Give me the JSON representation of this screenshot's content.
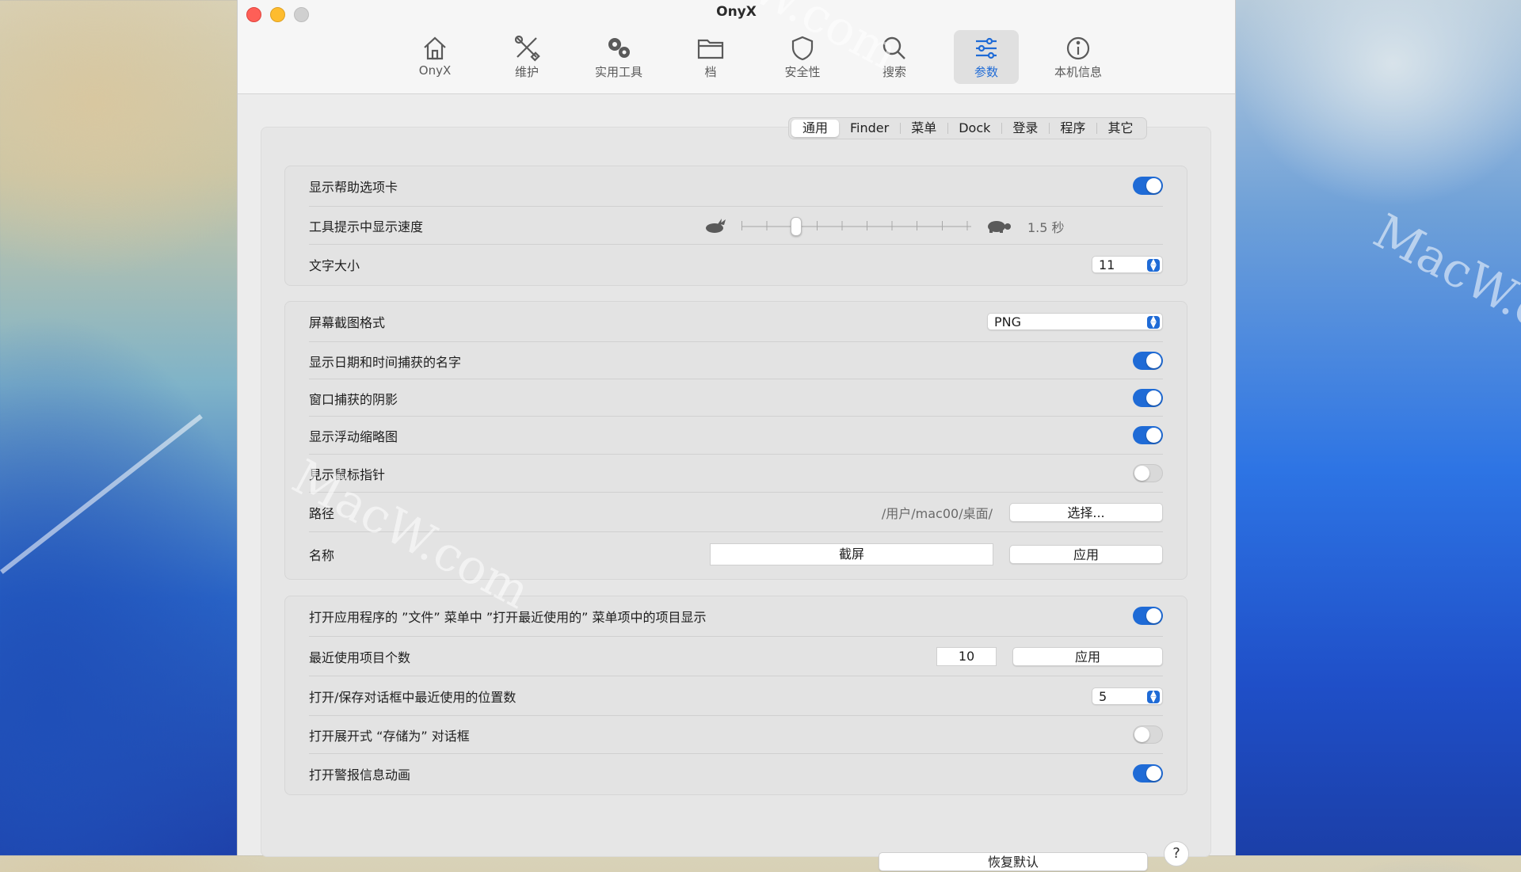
{
  "window": {
    "title": "OnyX"
  },
  "toolbar": {
    "items": [
      {
        "label": "OnyX",
        "icon": "house-icon"
      },
      {
        "label": "维护",
        "icon": "tools-icon"
      },
      {
        "label": "实用工具",
        "icon": "gears-icon"
      },
      {
        "label": "档",
        "icon": "folder-icon"
      },
      {
        "label": "安全性",
        "icon": "shield-icon"
      },
      {
        "label": "搜索",
        "icon": "search-icon"
      },
      {
        "label": "参数",
        "icon": "sliders-icon"
      },
      {
        "label": "本机信息",
        "icon": "info-icon"
      }
    ],
    "active_index": 6,
    "accent_color": "#1f6bd6"
  },
  "tabs": [
    "通用",
    "Finder",
    "菜单",
    "Dock",
    "登录",
    "程序",
    "其它"
  ],
  "active_tab_index": 0,
  "group1": {
    "show_help_tab": {
      "label": "显示帮助选项卡",
      "on": true
    },
    "tooltip_speed": {
      "label": "工具提示中显示速度",
      "value": "1.5 秒"
    },
    "text_size": {
      "label": "文字大小",
      "value": "11"
    }
  },
  "group2": {
    "screenshot_format": {
      "label": "屏幕截图格式",
      "value": "PNG"
    },
    "show_date_name": {
      "label": "显示日期和时间捕获的名字",
      "on": true
    },
    "window_shadow": {
      "label": "窗口捕获的阴影",
      "on": true
    },
    "floating_thumbnail": {
      "label": "显示浮动缩略图",
      "on": true
    },
    "show_cursor": {
      "label": "見示鼠标指针",
      "on": false
    },
    "path": {
      "label": "路径",
      "value": "/用户/mac00/桌面/",
      "button": "选择..."
    },
    "name": {
      "label": "名称",
      "value": "截屏",
      "button": "应用"
    }
  },
  "group3": {
    "recent_items_show": {
      "label": "打开应用程序的 ”文件” 菜单中 ”打开最近使用的” 菜单项中的项目显示",
      "on": true
    },
    "recent_count": {
      "label": "最近使用项目个数",
      "value": "10",
      "button": "应用"
    },
    "recent_places": {
      "label": "打开/保存对话框中最近使用的位置数",
      "value": "5"
    },
    "expand_save_as": {
      "label": "打开展开式 “存储为” 对话框",
      "on": false
    },
    "alert_animation": {
      "label": "打开警报信息动画",
      "on": true
    }
  },
  "footer": {
    "restore_button": "恢复默认",
    "help_button": "?"
  },
  "watermark": "MacW.com"
}
